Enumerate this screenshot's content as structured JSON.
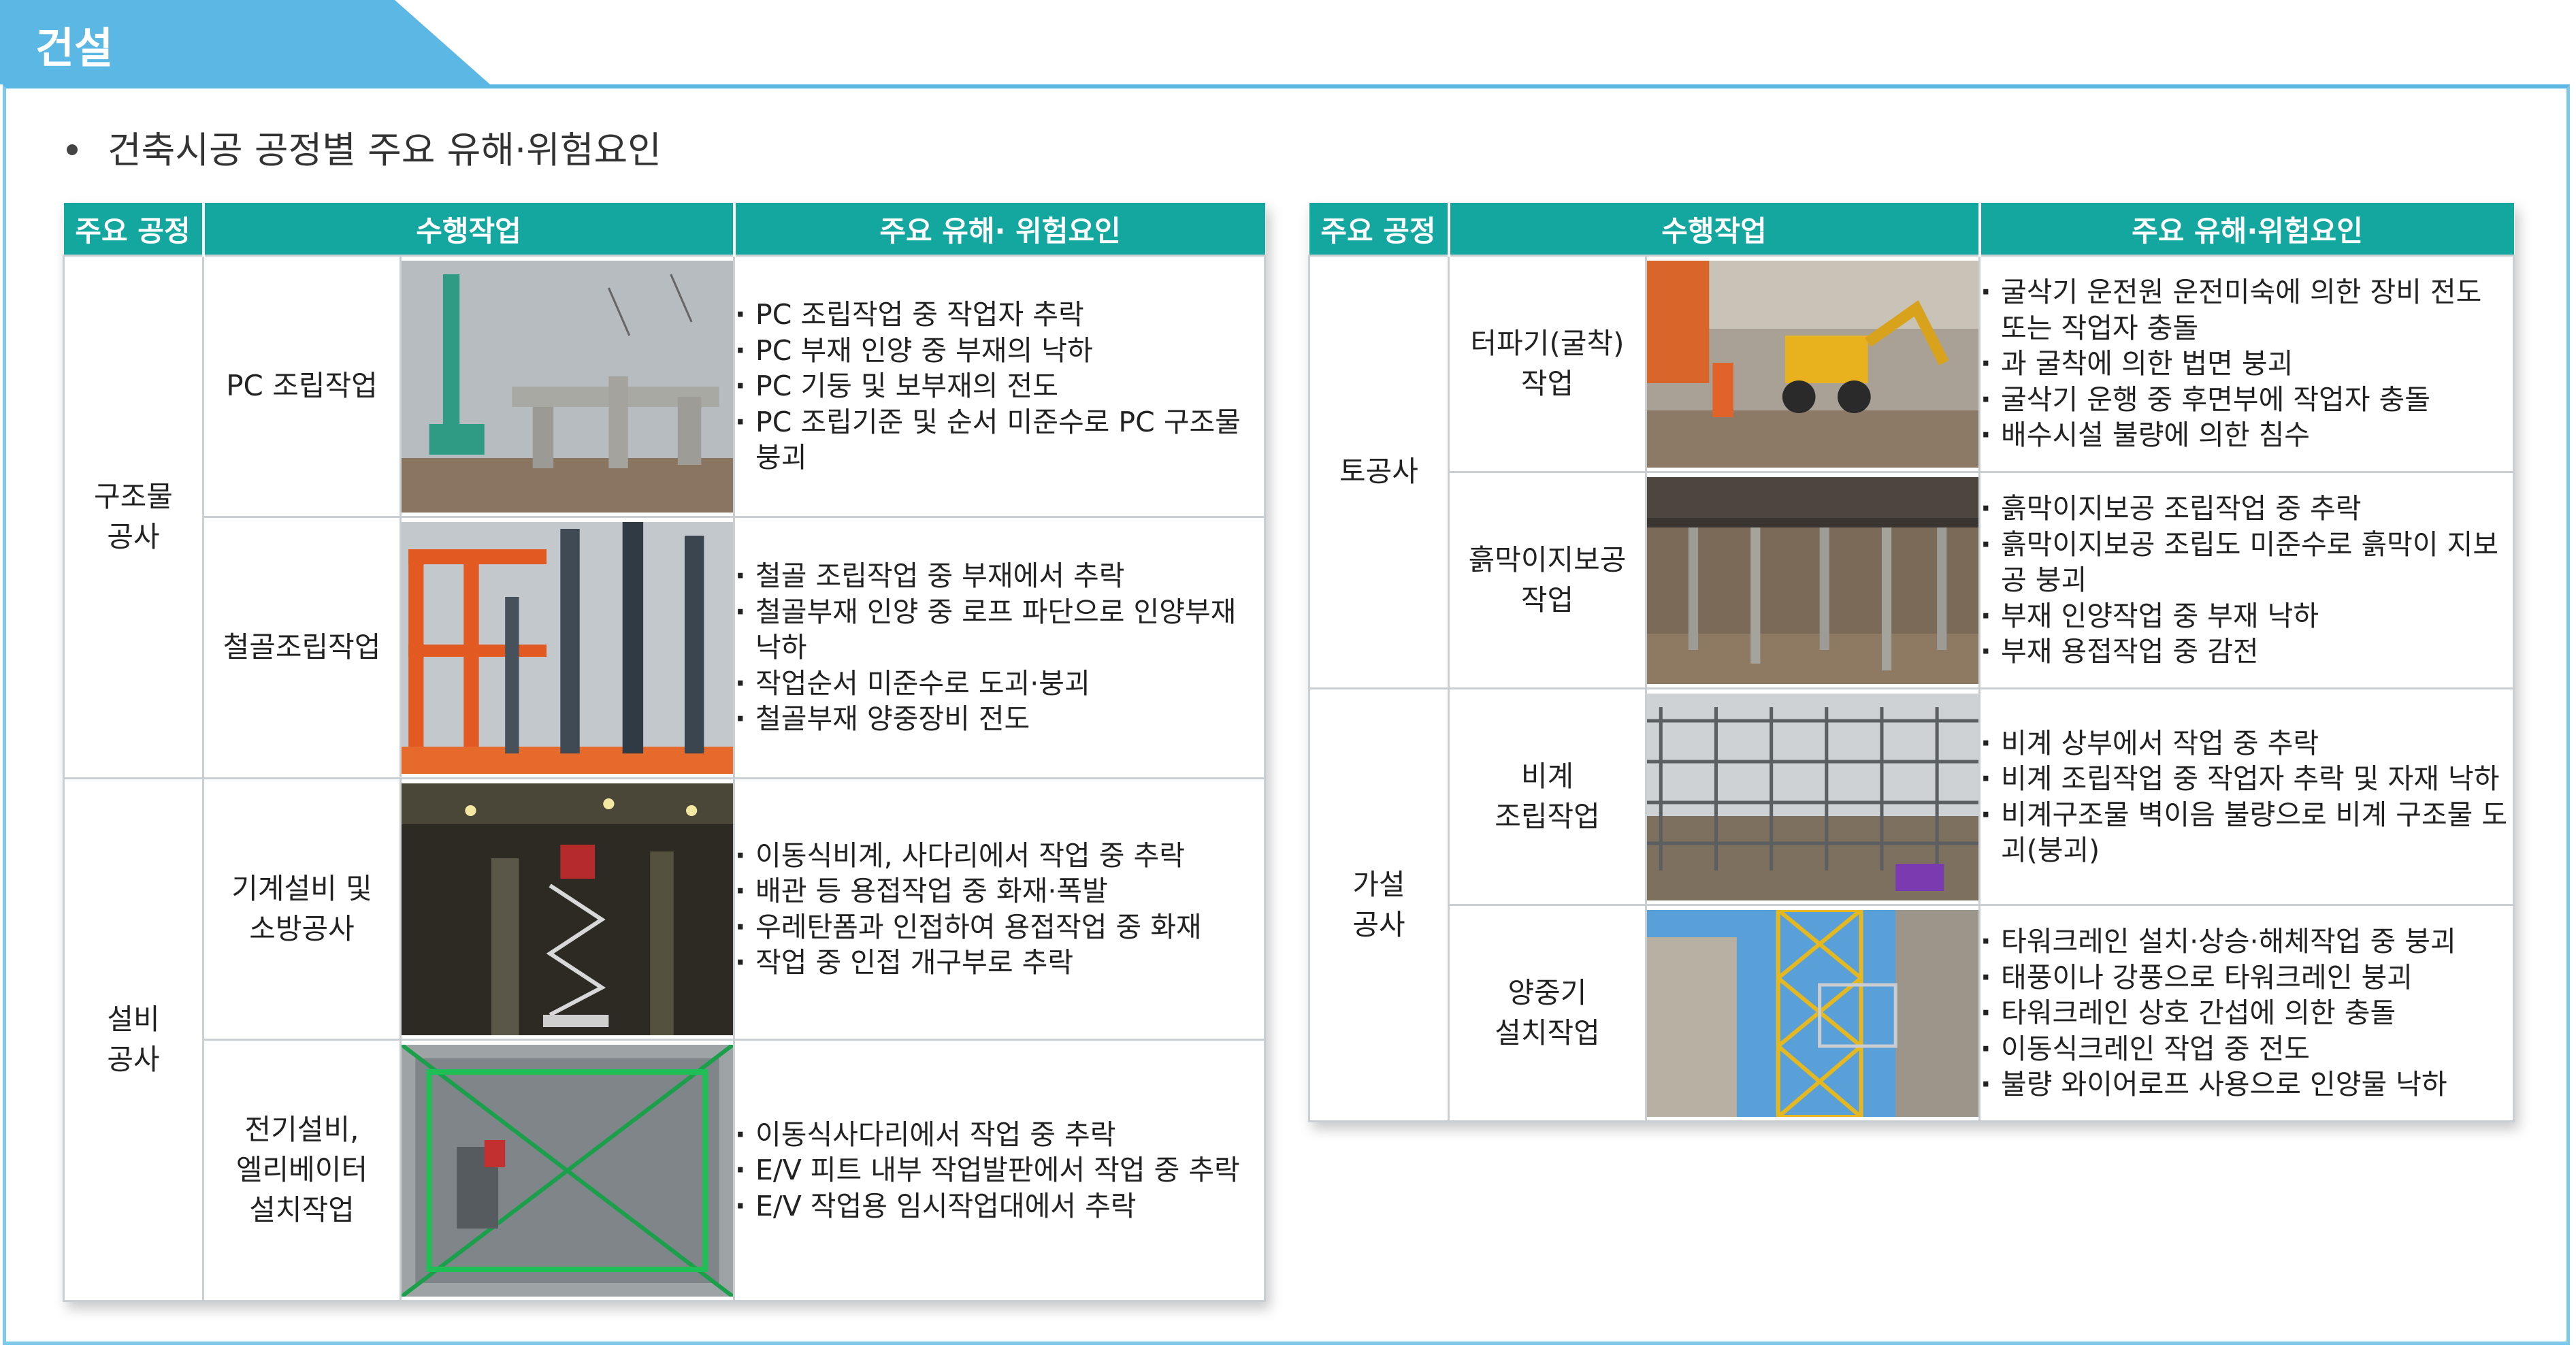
{
  "header": {
    "title": "건설"
  },
  "intro": {
    "text": "건축시공 공정별 주요 유해·위험요인"
  },
  "left_table": {
    "columns": [
      "주요 공정",
      "수행작업",
      "주요 유해· 위험요인"
    ],
    "groups": [
      {
        "process": "구조물\n공사",
        "rows": [
          {
            "task": "PC 조립작업",
            "hazards": [
              "PC 조립작업 중 작업자 추락",
              "PC 부재 인양 중 부재의 낙하",
              "PC 기둥 및 보부재의 전도",
              "PC 조립기준 및 순서 미준수로 PC 구조물 붕괴"
            ]
          },
          {
            "task": "철골조립작업",
            "hazards": [
              "철골 조립작업 중 부재에서 추락",
              "철골부재 인양 중 로프 파단으로 인양부재 낙하",
              "작업순서 미준수로 도괴·붕괴",
              "철골부재 양중장비 전도"
            ]
          }
        ]
      },
      {
        "process": "설비\n공사",
        "rows": [
          {
            "task": "기계설비 및\n소방공사",
            "hazards": [
              "이동식비계, 사다리에서 작업 중 추락",
              "배관 등 용접작업 중 화재·폭발",
              "우레탄폼과 인접하여 용접작업 중 화재",
              "작업 중 인접 개구부로 추락"
            ]
          },
          {
            "task": "전기설비,\n엘리베이터\n설치작업",
            "hazards": [
              "이동식사다리에서 작업 중 추락",
              "E/V 피트 내부 작업발판에서 작업 중 추락",
              "E/V 작업용 임시작업대에서 추락"
            ]
          }
        ]
      }
    ]
  },
  "right_table": {
    "columns": [
      "주요 공정",
      "수행작업",
      "주요 유해·위험요인"
    ],
    "groups": [
      {
        "process": "토공사",
        "rows": [
          {
            "task": "터파기(굴착)\n작업",
            "hazards": [
              "굴삭기 운전원 운전미숙에 의한 장비 전도 또는 작업자 충돌",
              "과 굴착에 의한 법면 붕괴",
              "굴삭기 운행 중 후면부에 작업자 충돌",
              "배수시설 불량에 의한 침수"
            ]
          },
          {
            "task": "흙막이지보공\n작업",
            "hazards": [
              "흙막이지보공 조립작업 중 추락",
              "흙막이지보공 조립도 미준수로 흙막이 지보공 붕괴",
              "부재 인양작업 중 부재 낙하",
              "부재 용접작업 중 감전"
            ]
          }
        ]
      },
      {
        "process": "가설\n공사",
        "rows": [
          {
            "task": "비계\n조립작업",
            "hazards": [
              "비계 상부에서 작업 중 추락",
              "비계 조립작업 중 작업자 추락 및 자재 낙하",
              "비계구조물 벽이음 불량으로 비계 구조물 도괴(붕괴)"
            ]
          },
          {
            "task": "양중기\n설치작업",
            "hazards": [
              "타워크레인 설치·상승·해체작업 중 붕괴",
              "태풍이나 강풍으로 타워크레인 붕괴",
              "타워크레인 상호 간섭에 의한 충돌",
              "이동식크레인 작업 중 전도",
              "불량 와이어로프 사용으로 인양물 낙하"
            ]
          }
        ]
      }
    ]
  }
}
